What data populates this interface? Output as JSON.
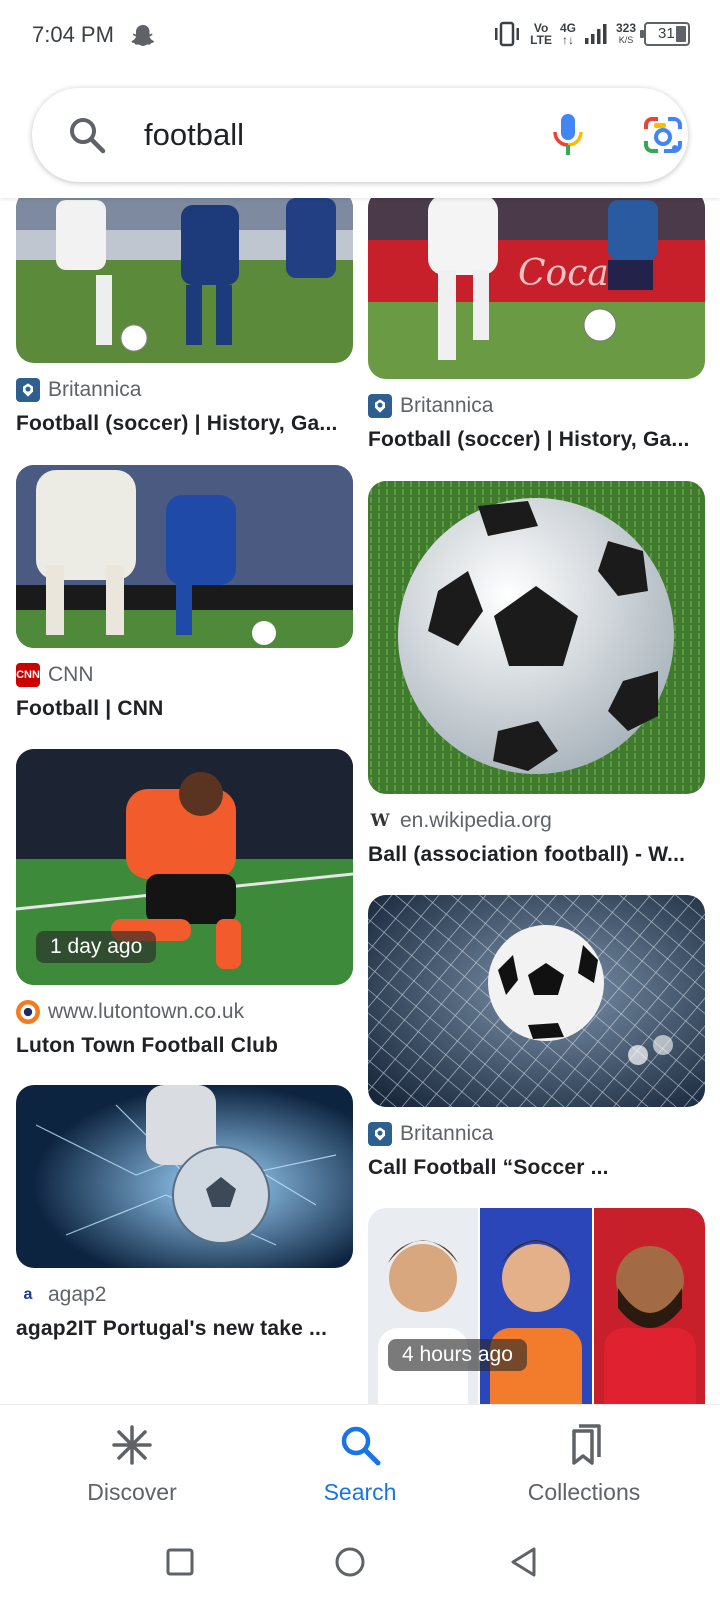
{
  "status_bar": {
    "time": "7:04 PM",
    "volte_top": "Vo",
    "volte_bottom": "LTE",
    "network_top": "4G",
    "network_bottom": "↑↓",
    "speed_value": "323",
    "speed_unit": "K/S",
    "battery": "31"
  },
  "search": {
    "query": "football",
    "icon": "search-icon"
  },
  "results": {
    "left": [
      {
        "source": "Britannica",
        "title": "Football (soccer) | History, Ga...",
        "favicon_color": "#2d5f8f",
        "time_badge": ""
      },
      {
        "source": "CNN",
        "title": "Football | CNN",
        "favicon_color": "#cc0000",
        "favicon_text": "CNN",
        "time_badge": ""
      },
      {
        "source": "www.lutontown.co.uk",
        "title": "Luton Town Football Club",
        "favicon_color": "#f47c20",
        "time_badge": "1 day ago"
      },
      {
        "source": "agap2",
        "title": "agap2IT Portugal's new take ...",
        "favicon_color": "#1e3a8a",
        "time_badge": ""
      }
    ],
    "right": [
      {
        "source": "Britannica",
        "title": "Football (soccer) | History, Ga...",
        "favicon_color": "#2d5f8f",
        "time_badge": ""
      },
      {
        "source": "en.wikipedia.org",
        "title": "Ball (association football) - W...",
        "favicon_color": "#ffffff",
        "favicon_text": "W",
        "time_badge": ""
      },
      {
        "source": "Britannica",
        "title": "Call Football “Soccer ...",
        "favicon_color": "#2d5f8f",
        "time_badge": ""
      },
      {
        "source": "",
        "title": "",
        "favicon_color": "",
        "time_badge": "4 hours ago"
      }
    ]
  },
  "bottom_nav": {
    "discover": "Discover",
    "search": "Search",
    "collections": "Collections",
    "active": "search",
    "active_color": "#1a73e8"
  }
}
